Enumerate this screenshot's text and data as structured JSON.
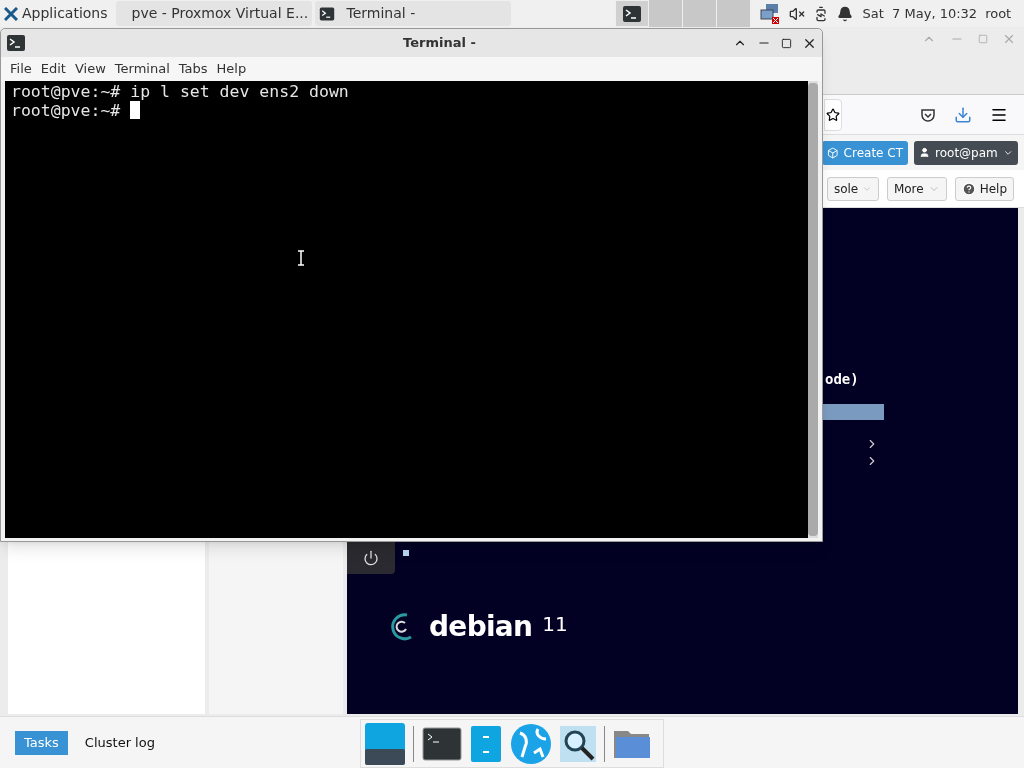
{
  "top_panel": {
    "applications": "Applications",
    "tasks": [
      {
        "title": "pve - Proxmox Virtual E...",
        "kind": "browser"
      },
      {
        "title": "Terminal -",
        "kind": "terminal"
      }
    ],
    "workspaces": [
      {
        "selected": true
      },
      {
        "selected": false
      },
      {
        "selected": false
      },
      {
        "selected": false
      }
    ],
    "clock": "Sat  7 May, 10:32",
    "user": "root"
  },
  "browser": {
    "header_buttons": [
      {
        "label": "Create CT",
        "kind": "create"
      },
      {
        "label": "root@pam",
        "kind": "user"
      }
    ],
    "toolbar": [
      {
        "label": "sole",
        "kind": "dropdown"
      },
      {
        "label": "More",
        "kind": "dropdown"
      },
      {
        "label": "Help",
        "kind": "help"
      }
    ],
    "console": {
      "text": "ode)",
      "logo": "debian",
      "version": "11"
    },
    "bottom_tabs": [
      {
        "label": "Tasks",
        "selected": true
      },
      {
        "label": "Cluster log",
        "selected": false
      }
    ]
  },
  "terminal": {
    "title": "Terminal -",
    "menu": [
      "File",
      "Edit",
      "View",
      "Terminal",
      "Tabs",
      "Help"
    ],
    "lines": [
      {
        "text": "root@pve:~# ip l set dev ens2 down",
        "cursor": false
      },
      {
        "text": "root@pve:~# ",
        "cursor": true
      }
    ]
  }
}
